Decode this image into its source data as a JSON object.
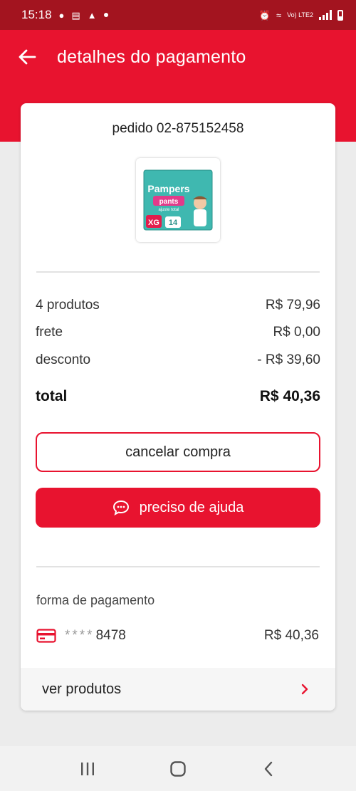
{
  "status_bar": {
    "time": "15:18",
    "network_label": "Vo) LTE2"
  },
  "header": {
    "title": "detalhes do pagamento",
    "back_icon": "arrow-left-icon"
  },
  "order": {
    "order_label": "pedido 02-875152458",
    "product_image_alt": "Pampers pants XG 14"
  },
  "summary": {
    "products_label": "4 produtos",
    "products_value": "R$ 79,96",
    "shipping_label": "frete",
    "shipping_value": "R$ 0,00",
    "discount_label": "desconto",
    "discount_value": "- R$ 39,60",
    "total_label": "total",
    "total_value": "R$ 40,36"
  },
  "actions": {
    "cancel_label": "cancelar compra",
    "help_label": "preciso de ajuda"
  },
  "payment": {
    "section_label": "forma de pagamento",
    "card_mask": "****",
    "card_last_digits": "8478",
    "amount": "R$ 40,36"
  },
  "footer_link": {
    "label": "ver produtos"
  },
  "colors": {
    "brand_red": "#e8132f",
    "status_bar": "#a3141f",
    "background": "#ececec"
  }
}
